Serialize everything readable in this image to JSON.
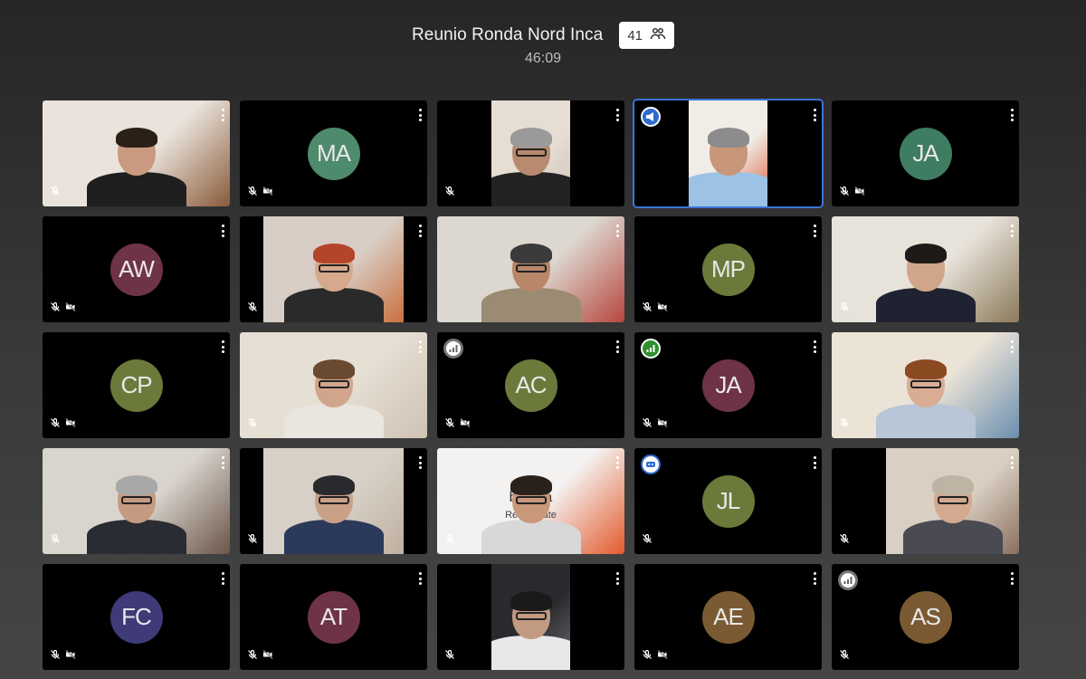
{
  "meeting": {
    "title": "Reunio Ronda Nord Inca",
    "participant_count": "41",
    "elapsed": "46:09",
    "people_icon": "people-icon"
  },
  "tiles": [
    {
      "kind": "video",
      "name": "video-man-beard",
      "mic": "muted-icon",
      "cam": "",
      "badge": "",
      "scene": {
        "bg": "#e9e3db",
        "wall": "#8a5a3a",
        "skin": "#c99a7f",
        "hair": "#2a2017",
        "shirt": "#1f1f1f",
        "glasses": false
      },
      "fit": "full"
    },
    {
      "kind": "avatar",
      "initials": "MA",
      "color": "#4e8a6c",
      "mic": "muted-icon",
      "cam": "camera-off-icon",
      "badge": ""
    },
    {
      "kind": "video",
      "name": "video-man-glasses-older",
      "mic": "muted-icon",
      "cam": "",
      "badge": "",
      "scene": {
        "bg": "#e6ded3",
        "wall": "#cfc4b6",
        "skin": "#b88a70",
        "hair": "#9a9a9a",
        "shirt": "#222",
        "glasses": true
      },
      "fit": "center"
    },
    {
      "kind": "video",
      "name": "video-speaker",
      "mic": "",
      "cam": "",
      "badge": "presenting",
      "speaking": true,
      "scene": {
        "bg": "#f1ede6",
        "wall": "#d95a3c",
        "skin": "#c89678",
        "hair": "#8c8c8c",
        "shirt": "#9cc3e6",
        "glasses": false
      },
      "fit": "center"
    },
    {
      "kind": "avatar",
      "initials": "JA",
      "color": "#3f7d62",
      "mic": "muted-icon",
      "cam": "camera-off-icon",
      "badge": ""
    },
    {
      "kind": "avatar",
      "initials": "AW",
      "color": "#6e3347",
      "mic": "muted-icon",
      "cam": "camera-off-icon",
      "badge": ""
    },
    {
      "kind": "video",
      "name": "video-woman-red-hair",
      "mic": "muted-icon",
      "cam": "",
      "badge": "",
      "scene": {
        "bg": "#d8cdc4",
        "wall": "#c9703f",
        "skin": "#d7a98c",
        "hair": "#b4452a",
        "shirt": "#2a2a2a",
        "glasses": true
      },
      "fit": "wide"
    },
    {
      "kind": "video",
      "name": "video-man-reading",
      "mic": "",
      "cam": "",
      "badge": "",
      "scene": {
        "bg": "#dcd7cf",
        "wall": "#b7463f",
        "skin": "#b9866a",
        "hair": "#3b3b3b",
        "shirt": "#9b8b73",
        "glasses": true
      },
      "fit": "full"
    },
    {
      "kind": "avatar",
      "initials": "MP",
      "color": "#6b7a3a",
      "mic": "muted-icon",
      "cam": "camera-off-icon",
      "badge": ""
    },
    {
      "kind": "video",
      "name": "video-young-man",
      "mic": "muted-icon",
      "cam": "",
      "badge": "",
      "scene": {
        "bg": "#e7e2da",
        "wall": "#8c7a5a",
        "skin": "#d0a58a",
        "hair": "#1e1a17",
        "shirt": "#1f2230",
        "glasses": false
      },
      "fit": "full"
    },
    {
      "kind": "avatar",
      "initials": "CP",
      "color": "#6b7a3a",
      "mic": "muted-icon",
      "cam": "camera-off-icon",
      "badge": ""
    },
    {
      "kind": "video",
      "name": "video-woman-thinking",
      "mic": "muted-icon",
      "cam": "",
      "badge": "",
      "scene": {
        "bg": "#e6dfd4",
        "wall": "#cfc3b3",
        "skin": "#d1a58c",
        "hair": "#6b4a32",
        "shirt": "#e9e5df",
        "glasses": true
      },
      "fit": "full"
    },
    {
      "kind": "avatar",
      "initials": "AC",
      "color": "#6b7a3a",
      "mic": "muted-icon",
      "cam": "camera-off-icon",
      "badge": "level-grey"
    },
    {
      "kind": "avatar",
      "initials": "JA",
      "color": "#6e3347",
      "mic": "muted-icon",
      "cam": "camera-off-icon",
      "badge": "level-green"
    },
    {
      "kind": "video",
      "name": "video-woman-older-glasses",
      "mic": "muted-icon",
      "cam": "",
      "badge": "",
      "scene": {
        "bg": "#ebe3d6",
        "wall": "#6b8fb0",
        "skin": "#d9ad93",
        "hair": "#8a4a22",
        "shirt": "#b9c6d8",
        "glasses": true
      },
      "fit": "full"
    },
    {
      "kind": "video",
      "name": "video-man-kitchen",
      "mic": "muted-icon",
      "cam": "",
      "badge": "",
      "scene": {
        "bg": "#d9d4cd",
        "wall": "#6b5548",
        "skin": "#c59a80",
        "hair": "#a8a8a8",
        "shirt": "#2a2c34",
        "glasses": true
      },
      "fit": "full"
    },
    {
      "kind": "video",
      "name": "video-woman-window",
      "mic": "muted-icon",
      "cam": "",
      "badge": "",
      "scene": {
        "bg": "#d7d0c6",
        "wall": "#bfb0a0",
        "skin": "#caa089",
        "hair": "#2a2a2e",
        "shirt": "#2b3a5a",
        "glasses": true
      },
      "fit": "wide"
    },
    {
      "kind": "video",
      "name": "video-man-office-sign",
      "mic": "muted-icon",
      "cam": "",
      "badge": "",
      "sign": "biliaria",
      "sign_sub": "Real Estate",
      "scene": {
        "bg": "#f3f2f0",
        "wall": "#e35a2c",
        "skin": "#c9977a",
        "hair": "#2a211b",
        "shirt": "#d8d8d8",
        "glasses": true
      },
      "fit": "full"
    },
    {
      "kind": "avatar",
      "initials": "JL",
      "color": "#6b7a3a",
      "mic": "muted-icon",
      "cam": "",
      "badge": "robot"
    },
    {
      "kind": "video",
      "name": "video-woman-corner",
      "mic": "muted-icon",
      "cam": "",
      "badge": "",
      "scene": {
        "bg": "#d9cfc2",
        "wall": "#8a7060",
        "skin": "#d4a98f",
        "hair": "#bfb3a3",
        "shirt": "#4a4a52",
        "glasses": true
      },
      "fit": "right"
    },
    {
      "kind": "avatar",
      "initials": "FC",
      "color": "#3f3b78",
      "mic": "muted-icon",
      "cam": "camera-off-icon",
      "badge": ""
    },
    {
      "kind": "avatar",
      "initials": "AT",
      "color": "#6e3347",
      "mic": "muted-icon",
      "cam": "camera-off-icon",
      "badge": ""
    },
    {
      "kind": "video",
      "name": "video-man-blinds",
      "mic": "muted-icon",
      "cam": "",
      "badge": "",
      "scene": {
        "bg": "#2a2a2e",
        "wall": "#6b6b70",
        "skin": "#c29a82",
        "hair": "#1a1a1a",
        "shirt": "#e8e8ea",
        "glasses": true
      },
      "fit": "center"
    },
    {
      "kind": "avatar",
      "initials": "AE",
      "color": "#7a5a32",
      "mic": "muted-icon",
      "cam": "camera-off-icon",
      "badge": ""
    },
    {
      "kind": "avatar",
      "initials": "AS",
      "color": "#7a5a32",
      "mic": "muted-icon",
      "cam": "",
      "badge": "level-grey"
    }
  ]
}
